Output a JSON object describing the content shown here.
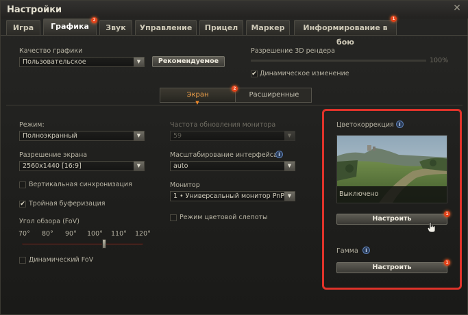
{
  "window": {
    "title": "Настройки"
  },
  "tabs": [
    {
      "label": "Игра"
    },
    {
      "label": "Графика",
      "badge": "2"
    },
    {
      "label": "Звук"
    },
    {
      "label": "Управление"
    },
    {
      "label": "Прицел"
    },
    {
      "label": "Маркер"
    },
    {
      "label": "Информирование в бою",
      "badge": "1"
    }
  ],
  "graphics": {
    "quality_label": "Качество графики",
    "quality_value": "Пользовательское",
    "recommended_button": "Рекомендуемое",
    "render_resolution_label": "Разрешение 3D рендера",
    "render_resolution_value": "100%",
    "render_resolution_fraction": 1.0,
    "dynamic_change_label": "Динамическое изменение",
    "dynamic_change_checked": true
  },
  "subtabs": {
    "screen": "Экран",
    "screen_badge": "2",
    "advanced": "Расширенные"
  },
  "screen": {
    "mode_label": "Режим:",
    "mode_value": "Полноэкранный",
    "resolution_label": "Разрешение экрана",
    "resolution_value": "2560x1440 [16:9]",
    "vsync_label": "Вертикальная синхронизация",
    "vsync_checked": false,
    "triple_buffer_label": "Тройная буферизация",
    "triple_buffer_checked": true,
    "fov_label": "Угол обзора (FoV)",
    "fov_ticks": [
      "70°",
      "80°",
      "90°",
      "100°",
      "110°",
      "120°"
    ],
    "fov_fraction": 0.68,
    "dynamic_fov_label": "Динамический FoV",
    "dynamic_fov_checked": false,
    "refresh_label": "Частота обновления монитора",
    "refresh_value": "59",
    "ui_scale_label": "Масштабирование интерфейса",
    "ui_scale_value": "auto",
    "monitor_label": "Монитор",
    "monitor_value": "1 • Универсальный монитор PnP (",
    "colorblind_label": "Режим цветовой слепоты",
    "colorblind_checked": false
  },
  "color_panel": {
    "color_correction_label": "Цветокоррекция",
    "color_correction_status": "Выключено",
    "configure_button": "Настроить",
    "configure_badge": "1",
    "gamma_label": "Гамма",
    "gamma_button": "Настроить",
    "gamma_badge": "1"
  },
  "icons": {
    "close": "close-icon",
    "info": "info-icon",
    "dropdown": "chevron-down-icon",
    "check": "checkmark-icon",
    "cursor": "hand-cursor-icon"
  },
  "colors": {
    "accent_orange": "#f0a04a",
    "badge_red": "#e2421a",
    "highlight_red": "#e0332a"
  }
}
